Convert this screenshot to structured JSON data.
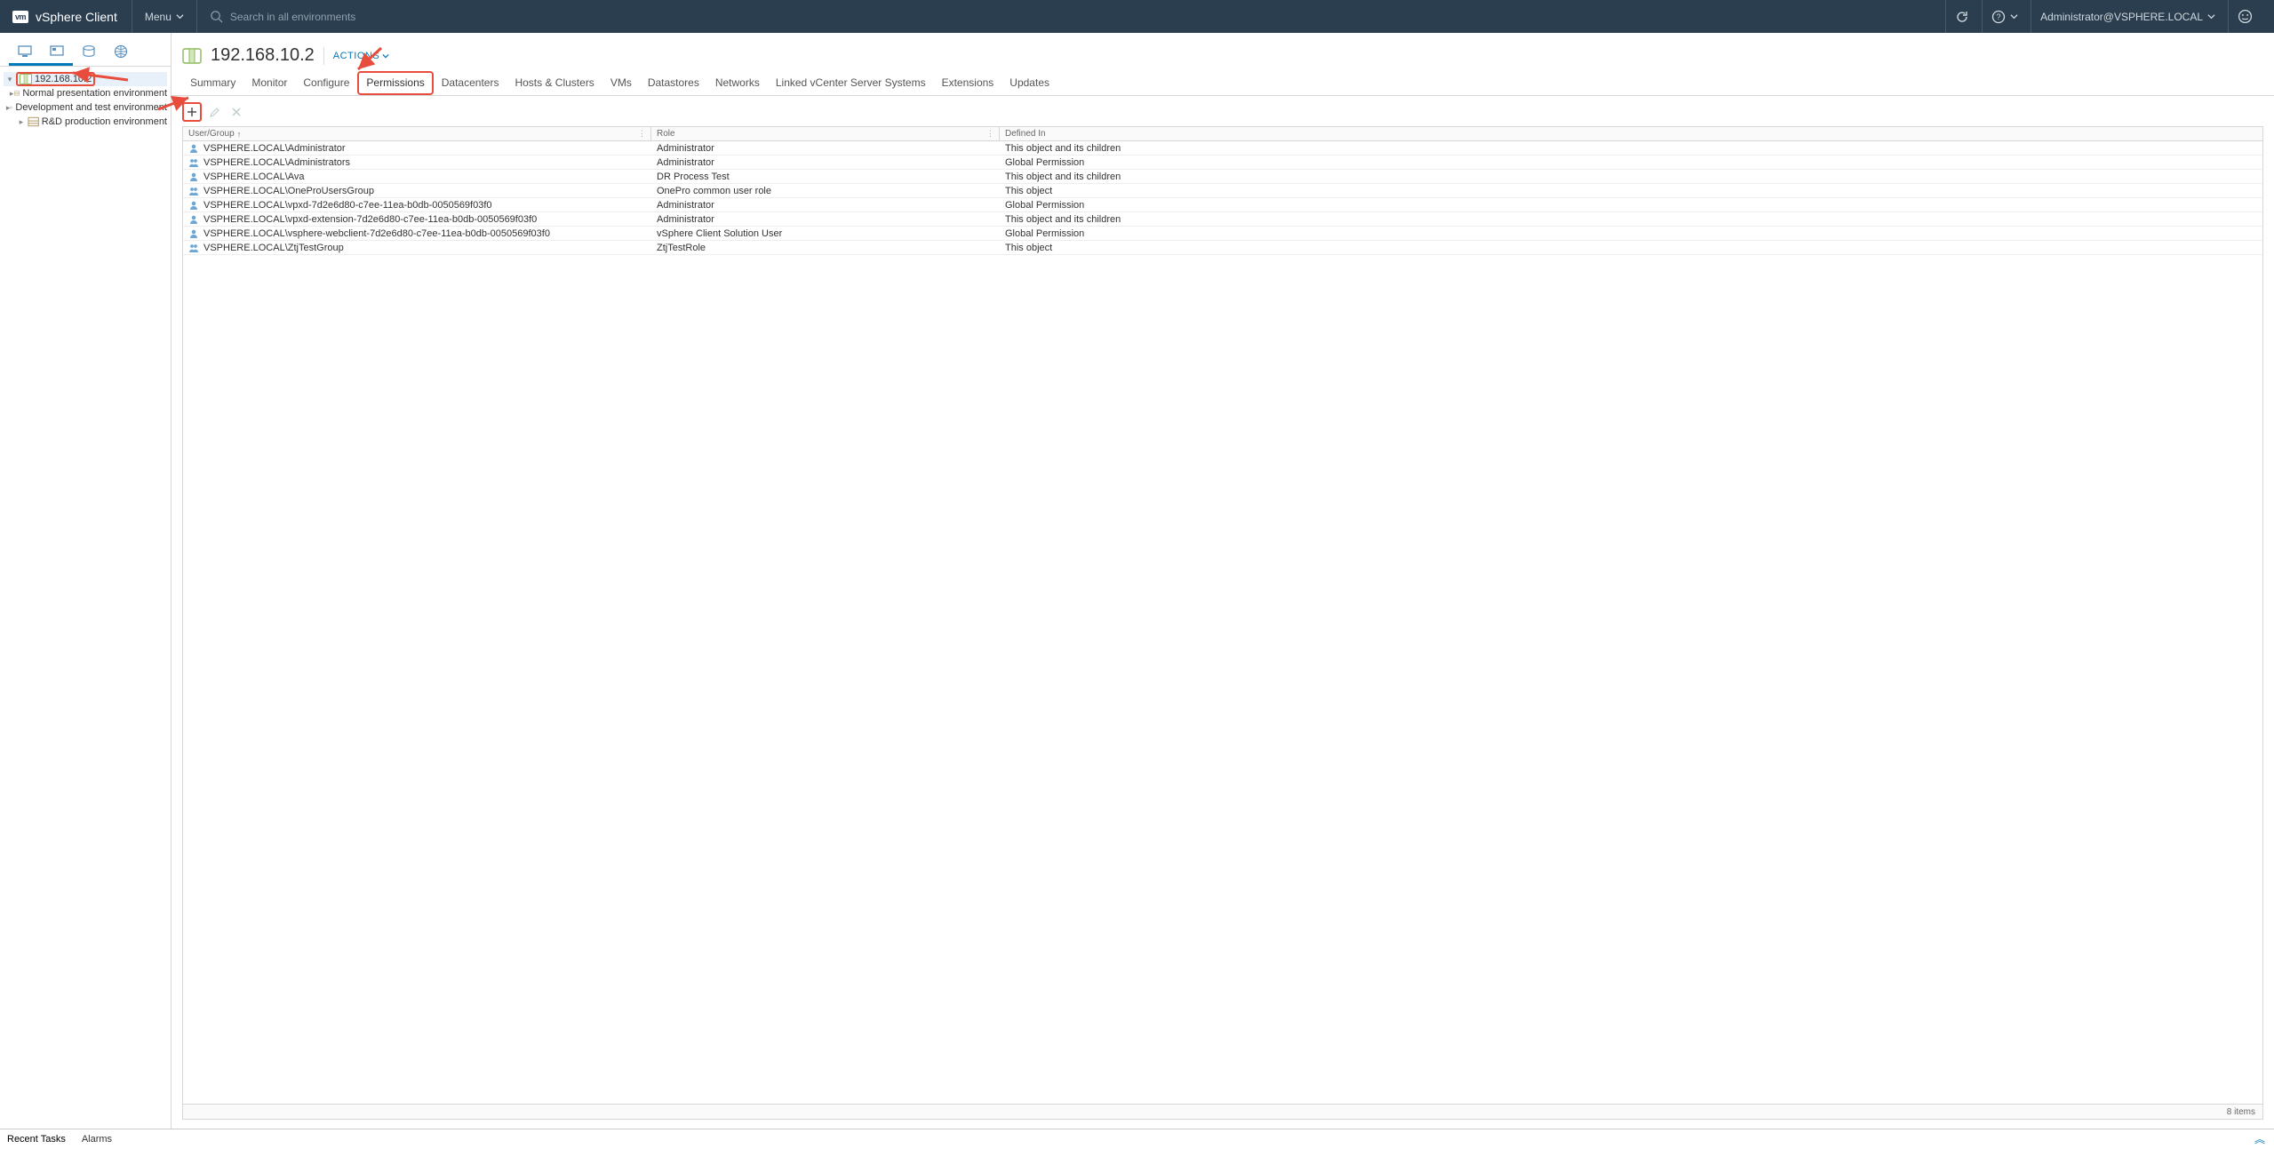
{
  "header": {
    "app": "vSphere Client",
    "menu": "Menu",
    "search_placeholder": "Search in all environments",
    "user": "Administrator@VSPHERE.LOCAL"
  },
  "sidebar": {
    "root": "192.168.10.2",
    "items": [
      "Normal presentation environment",
      "Development and test environment",
      "R&D production environment"
    ]
  },
  "main": {
    "title": "192.168.10.2",
    "actions": "ACTIONS",
    "tabs": [
      "Summary",
      "Monitor",
      "Configure",
      "Permissions",
      "Datacenters",
      "Hosts & Clusters",
      "VMs",
      "Datastores",
      "Networks",
      "Linked vCenter Server Systems",
      "Extensions",
      "Updates"
    ],
    "active_tab": 3,
    "columns": {
      "c1": "User/Group",
      "c2": "Role",
      "c3": "Defined In"
    },
    "rows": [
      {
        "type": "user",
        "name": "VSPHERE.LOCAL\\Administrator",
        "role": "Administrator",
        "def": "This object and its children"
      },
      {
        "type": "group",
        "name": "VSPHERE.LOCAL\\Administrators",
        "role": "Administrator",
        "def": "Global Permission"
      },
      {
        "type": "user",
        "name": "VSPHERE.LOCAL\\Ava",
        "role": "DR Process Test",
        "def": "This object and its children"
      },
      {
        "type": "group",
        "name": "VSPHERE.LOCAL\\OneProUsersGroup",
        "role": "OnePro common user role",
        "def": "This object"
      },
      {
        "type": "user",
        "name": "VSPHERE.LOCAL\\vpxd-7d2e6d80-c7ee-11ea-b0db-0050569f03f0",
        "role": "Administrator",
        "def": "Global Permission"
      },
      {
        "type": "user",
        "name": "VSPHERE.LOCAL\\vpxd-extension-7d2e6d80-c7ee-11ea-b0db-0050569f03f0",
        "role": "Administrator",
        "def": "This object and its children"
      },
      {
        "type": "user",
        "name": "VSPHERE.LOCAL\\vsphere-webclient-7d2e6d80-c7ee-11ea-b0db-0050569f03f0",
        "role": "vSphere Client Solution User",
        "def": "Global Permission"
      },
      {
        "type": "group",
        "name": "VSPHERE.LOCAL\\ZtjTestGroup",
        "role": "ZtjTestRole",
        "def": "This object"
      }
    ],
    "footer_count": "8 items"
  },
  "footer": {
    "tabs": [
      "Recent Tasks",
      "Alarms"
    ]
  }
}
